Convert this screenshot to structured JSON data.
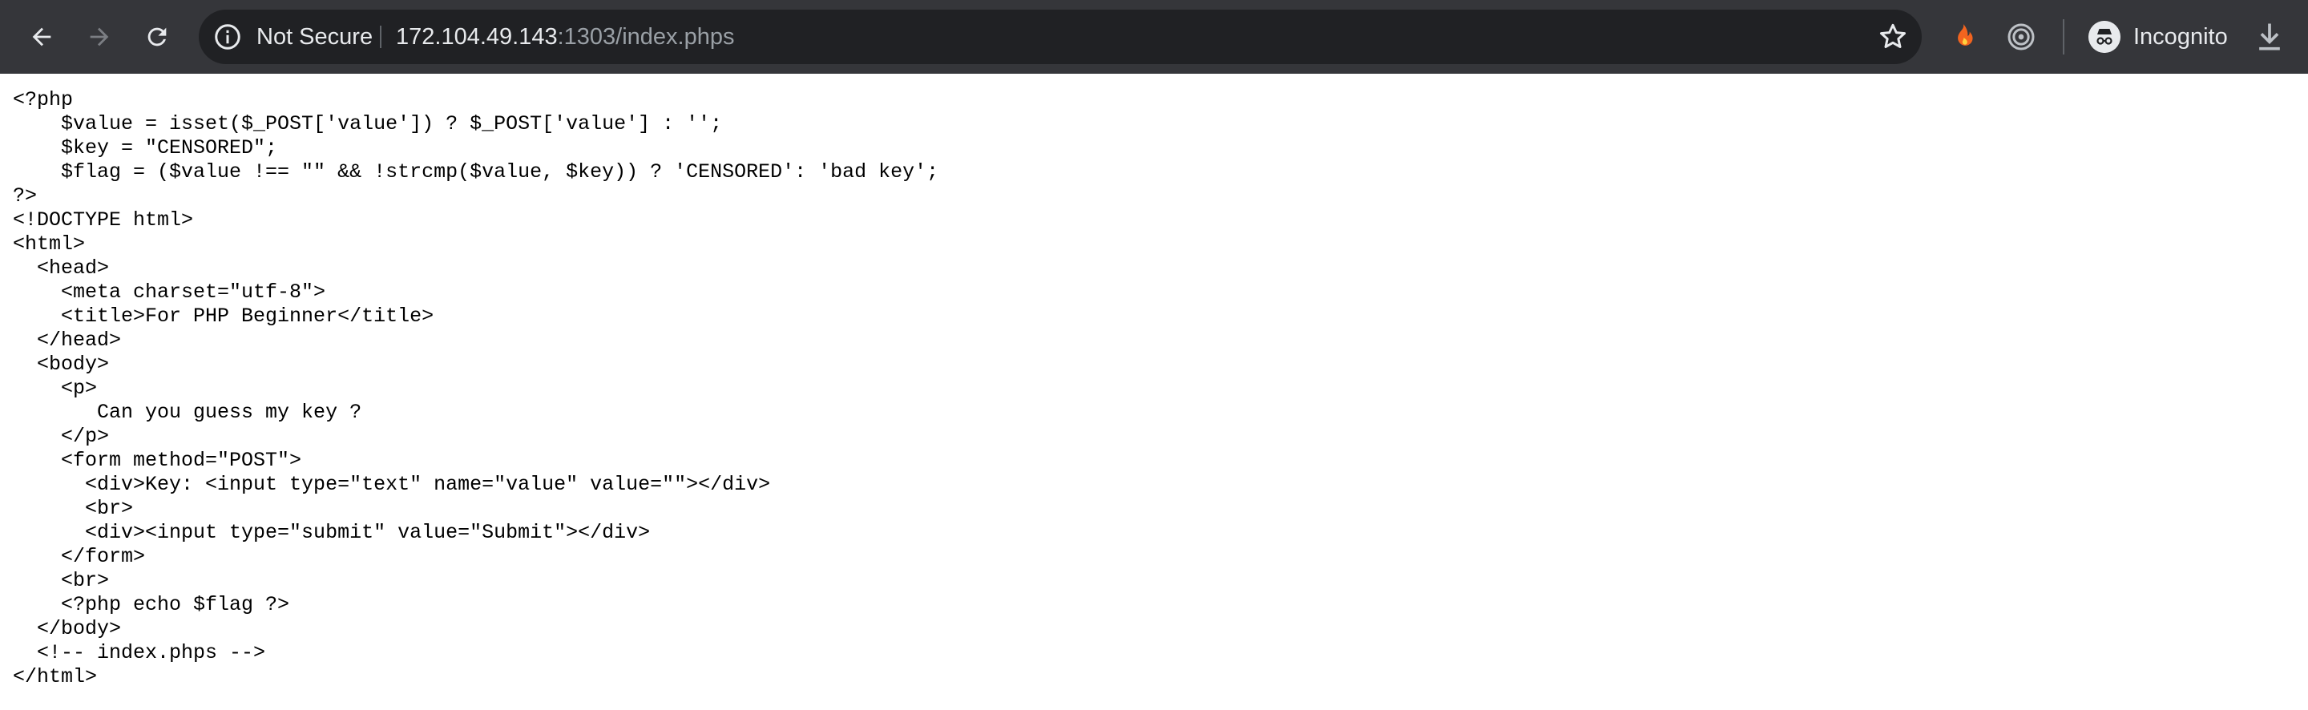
{
  "browser": {
    "security_label": "Not Secure",
    "url_host": "172.104.49.143",
    "url_rest": ":1303/index.phps",
    "profile_label": "Incognito",
    "icons": {
      "back": "back-arrow-icon",
      "forward": "forward-arrow-icon",
      "reload": "reload-icon",
      "info": "info-icon",
      "bookmark": "star-icon",
      "extension_1": "fire-icon",
      "extension_2": "target-icon",
      "incognito": "incognito-icon",
      "download": "download-icon"
    },
    "colors": {
      "toolbar": "#35363a",
      "omnibox": "#202124",
      "text": "#e8eaed",
      "url_dim": "#9aa0a6",
      "extension_fire": "#f2641f"
    }
  },
  "page": {
    "source_lines": [
      "<?php",
      "    $value = isset($_POST['value']) ? $_POST['value'] : '';",
      "    $key = \"CENSORED\";",
      "    $flag = ($value !== \"\" && !strcmp($value, $key)) ? 'CENSORED': 'bad key';",
      "?>",
      "<!DOCTYPE html>",
      "<html>",
      "  <head>",
      "    <meta charset=\"utf-8\">",
      "    <title>For PHP Beginner</title>",
      "  </head>",
      "  <body>",
      "    <p>",
      "       Can you guess my key ?",
      "    </p>",
      "    <form method=\"POST\">",
      "      <div>Key: <input type=\"text\" name=\"value\" value=\"\"></div>",
      "      <br>",
      "      <div><input type=\"submit\" value=\"Submit\"></div>",
      "    </form>",
      "    <br>",
      "    <?php echo $flag ?>",
      "  </body>",
      "  <!-- index.phps -->",
      "</html>"
    ]
  }
}
